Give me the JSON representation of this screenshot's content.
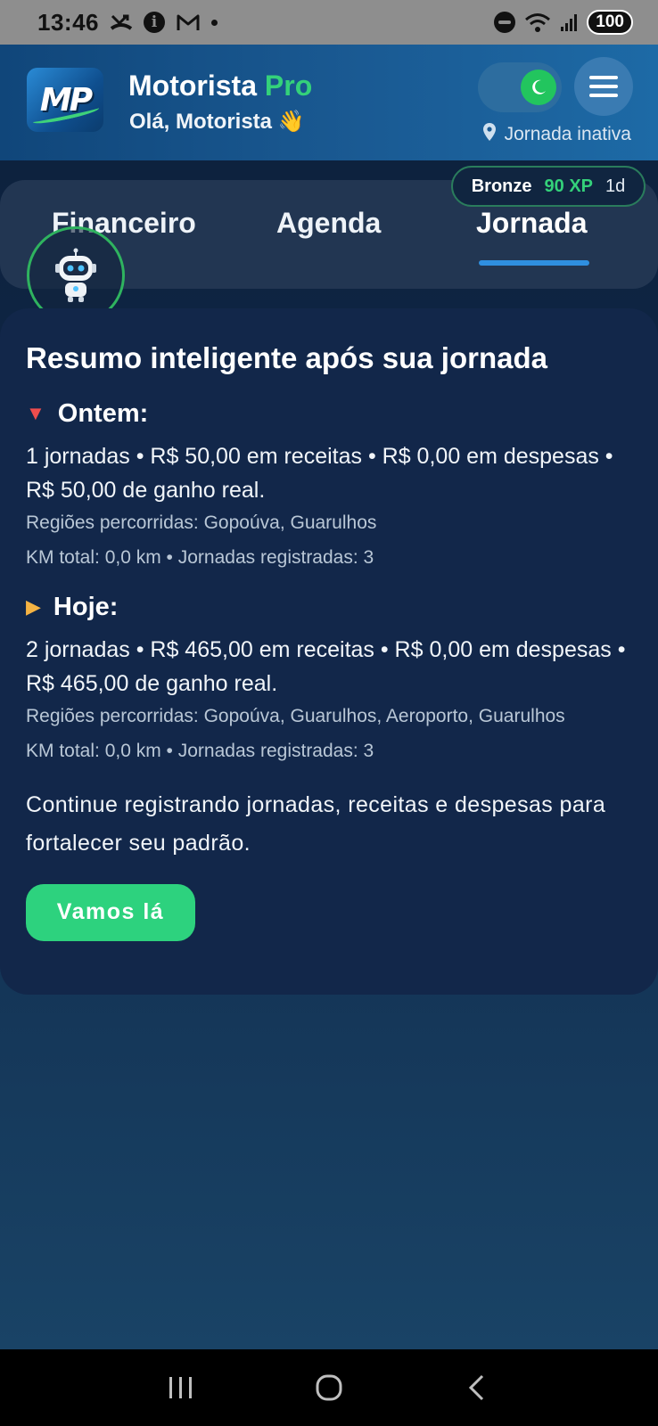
{
  "status_bar": {
    "time": "13:46",
    "battery": "100",
    "icons": [
      "missed-call-icon",
      "info-icon",
      "gmail-icon",
      "dot-icon",
      "do-not-disturb-icon",
      "wifi-icon",
      "signal-icon",
      "battery-icon"
    ]
  },
  "header": {
    "logo_text": "MP",
    "brand_name": "Motorista",
    "brand_suffix": "Pro",
    "greeting": "Olá, Motorista 👋",
    "journey_status": "Jornada inativa",
    "theme_toggle_state": "dark",
    "accent_color": "#34d17a"
  },
  "tabs": [
    {
      "label": "Financeiro",
      "active": false
    },
    {
      "label": "Agenda",
      "active": false
    },
    {
      "label": "Jornada",
      "active": true
    }
  ],
  "xp_badge": {
    "rank": "Bronze",
    "xp": "90 XP",
    "days": "1d"
  },
  "summary": {
    "title": "Resumo inteligente após sua jornada",
    "yesterday": {
      "heading": "Ontem:",
      "main": "1 jornadas • R$ 50,00 em receitas • R$ 0,00 em despesas • R$ 50,00 de ganho real.",
      "regions": "Regiões percorridas: Gopoúva, Guarulhos",
      "km": "KM total: 0,0 km • Jornadas registradas: 3"
    },
    "today": {
      "heading": "Hoje:",
      "main": "2 jornadas • R$ 465,00 em receitas • R$ 0,00 em despesas • R$ 465,00 de ganho real.",
      "regions": "Regiões percorridas: Gopoúva, Guarulhos, Aeroporto, Guarulhos",
      "km": "KM total: 0,0 km • Jornadas registradas: 3"
    },
    "closing": "Continue registrando jornadas, receitas e despesas para fortalecer seu padrão.",
    "cta_label": "Vamos lá"
  },
  "nav": {
    "icons": [
      "recents-icon",
      "home-icon",
      "back-icon"
    ]
  }
}
